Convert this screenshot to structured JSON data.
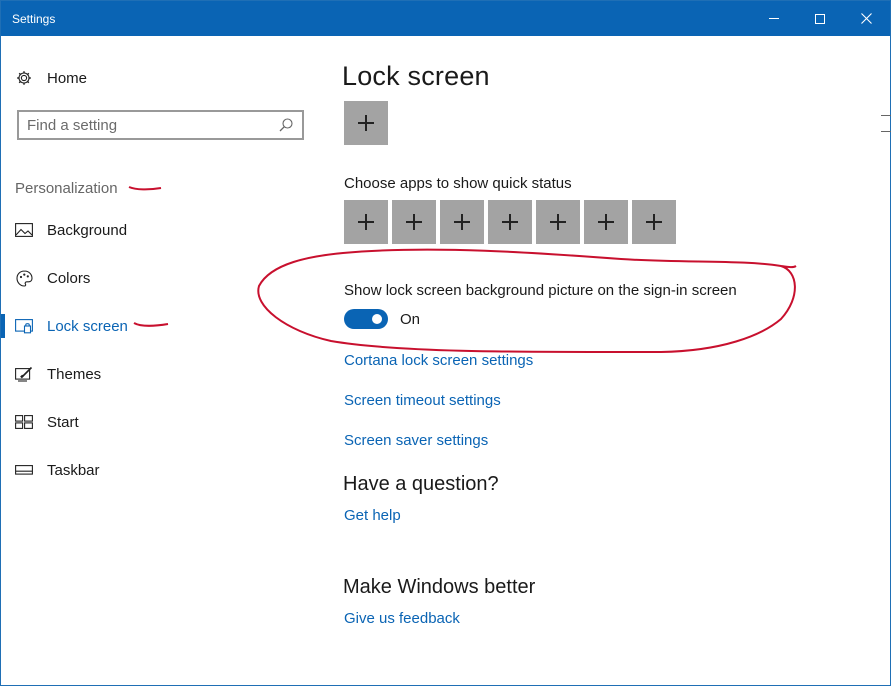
{
  "window": {
    "title": "Settings",
    "minimize_icon": "minimize-icon",
    "maximize_icon": "maximize-icon",
    "close_glyph": "✕"
  },
  "sidebar": {
    "home_label": "Home",
    "search_placeholder": "Find a setting",
    "section_label": "Personalization",
    "items": [
      {
        "label": "Background",
        "icon": "picture-icon"
      },
      {
        "label": "Colors",
        "icon": "palette-icon"
      },
      {
        "label": "Lock screen",
        "icon": "lock-screen-icon",
        "active": true
      },
      {
        "label": "Themes",
        "icon": "themes-icon"
      },
      {
        "label": "Start",
        "icon": "start-icon"
      },
      {
        "label": "Taskbar",
        "icon": "taskbar-icon"
      }
    ]
  },
  "main": {
    "title": "Lock screen",
    "quick_status_label": "Choose apps to show quick status",
    "quick_status_tile_count": 7,
    "background_signin_label": "Show lock screen background picture on the sign-in screen",
    "background_signin_toggle": {
      "state": "On",
      "on": true
    },
    "links": {
      "cortana": "Cortana lock screen settings",
      "timeout": "Screen timeout settings",
      "saver": "Screen saver settings"
    },
    "question_heading": "Have a question?",
    "get_help": "Get help",
    "better_heading": "Make Windows better",
    "feedback": "Give us feedback"
  },
  "colors": {
    "accent": "#0a64b4",
    "annotation": "#c8102e",
    "tile": "#a3a3a3"
  }
}
